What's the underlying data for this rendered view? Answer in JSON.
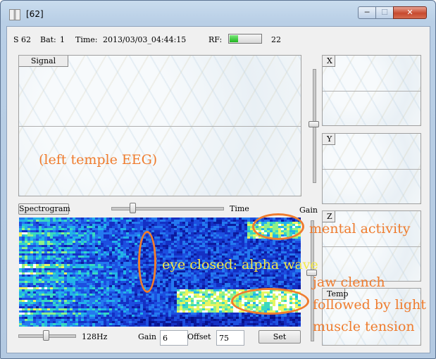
{
  "window": {
    "title": "[62]",
    "min_glyph": "─",
    "max_glyph": "☐",
    "close_glyph": "✕"
  },
  "status": {
    "sensor": "S 62",
    "bat_label": "Bat:",
    "bat_value": "1",
    "time_label": "Time:",
    "time_value": "2013/03/03_04:44:15",
    "rf_label": "RF:",
    "rf_level": 0.25,
    "rf_value": "22"
  },
  "panels": {
    "signal": "Signal",
    "x": "X",
    "y": "Y",
    "z": "Z",
    "temp": "Temp",
    "spectrogram": "Spectrogram"
  },
  "controls": {
    "time_label": "Time",
    "gain_top_label": "Gain",
    "freq_label": "128Hz",
    "gain_label": "Gain",
    "gain_value": "6",
    "offset_label": "Offset",
    "offset_value": "75",
    "set_label": "Set"
  },
  "annotations": {
    "left_temple": "(left temple EEG)",
    "mental_activity": "mental activity",
    "eye_closed": "eye closed: alpha wave",
    "jaw_1": "jaw clench",
    "jaw_2": "followed by light",
    "jaw_3": "muscle tension"
  },
  "colors": {
    "annotation_orange": "#ef7c2e",
    "annotation_yellow": "#f3e94a",
    "spectrogram_base": "#0c1a9e"
  }
}
